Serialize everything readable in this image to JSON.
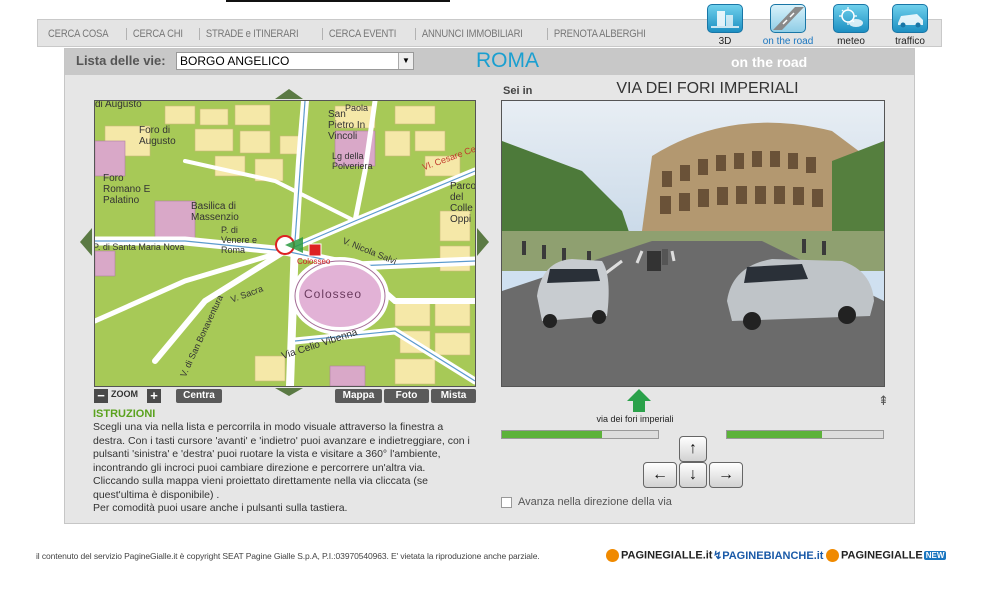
{
  "nav": {
    "items": [
      "CERCA COSA",
      "CERCA CHI",
      "STRADE e ITINERARI",
      "CERCA EVENTI",
      "ANNUNCI IMMOBILIARI",
      "PRENOTA ALBERGHI"
    ]
  },
  "tools": [
    {
      "label": "3D",
      "icon": "3d-map-icon"
    },
    {
      "label": "on the road",
      "icon": "road-icon",
      "active": true
    },
    {
      "label": "meteo",
      "icon": "weather-icon"
    },
    {
      "label": "traffico",
      "icon": "car-icon"
    }
  ],
  "header": {
    "lista_label": "Lista delle vie:",
    "selected_street": "BORGO ANGELICO",
    "city": "ROMA",
    "section": "on the road"
  },
  "map": {
    "labels": [
      "di Augusto",
      "Foro di Augusto",
      "Foro Romano E Palatino",
      "Basilica di Massenzio",
      "P. di Venere e Roma",
      "P. di Santa Maria Nova",
      "Paola",
      "San Pietro In Vincoli",
      "Lg della Polveriera",
      "Vl. Cesare Ce",
      "Parco del Colle Oppi",
      "Colosseo",
      "Colosseo",
      "V. Nicola Salvi",
      "V. Sacra",
      "V. di San Bonaventura",
      "Via Celio Vibenna"
    ],
    "zoom_label": "ZOOM",
    "centra": "Centra",
    "mappa": "Mappa",
    "foto": "Foto",
    "mista": "Mista"
  },
  "viewer": {
    "sei_in": "Sei in",
    "street_name": "VIA DEI FORI IMPERIALI",
    "position_label": "via dei fori imperiali",
    "progress_left": 0.64,
    "progress_right": 0.61,
    "checkbox_label": "Avanza nella direzione della via",
    "keys": {
      "up": "↑",
      "left": "←",
      "down": "↓",
      "right": "→"
    }
  },
  "instructions": {
    "title": "ISTRUZIONI",
    "lines": [
      "Scegli una via nella lista e percorrila in modo visuale attraverso la finestra a destra. Con i tasti cursore 'avanti' e 'indietro' puoi avanzare e indietreggiare, con i pulsanti 'sinistra' e 'destra' puoi ruotare la vista e visitare a 360° l'ambiente, incontrando gli incroci puoi cambiare direzione e percorrere un'altra via.",
      "Cliccando sulla mappa vieni proiettato direttamente nella via cliccata (se quest'ultima è disponibile) .",
      "Per comodità puoi usare anche i pulsanti sulla tastiera."
    ]
  },
  "footer": {
    "copyright": "il contenuto del servizio PagineGialle.it è copyright SEAT Pagine Gialle S.p.A, P.I.:03970540963. E' vietata la riproduzione anche parziale.",
    "logos": [
      "PAGINEGIALLE.it",
      "PAGINEBIANCHE.it",
      "PAGINEGIALLE"
    ],
    "logo_badge": "NEW"
  },
  "colors": {
    "accent": "#1a9fd0",
    "green": "#5aa21e",
    "map_park": "#a7c957"
  }
}
